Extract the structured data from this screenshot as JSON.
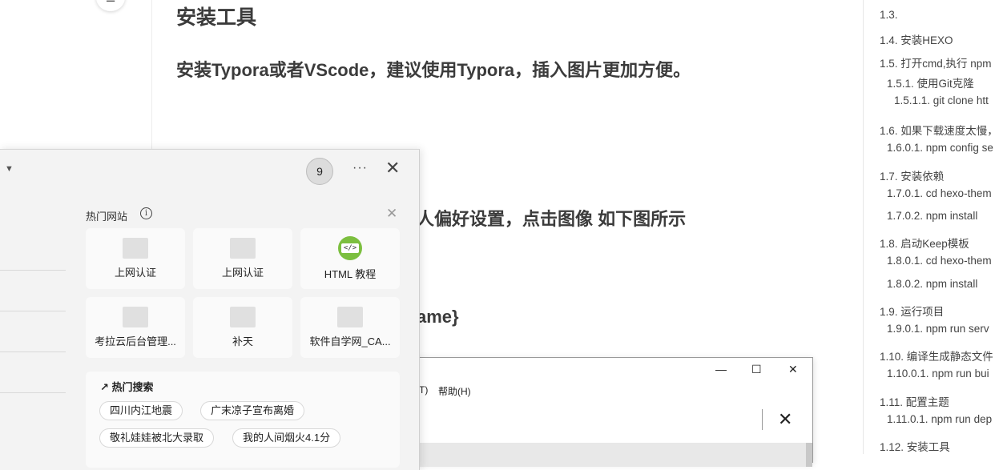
{
  "article": {
    "heading": "安装工具",
    "paragraph": "安装Typora或者VScode，建议使用Typora，插入图片更加方便。",
    "partial_pref": "人偏好设置，点击图像 如下图所示",
    "partial_name": "ame}"
  },
  "toc": {
    "items": [
      "1.3.",
      "1.4. 安装HEXO",
      "1.5. 打开cmd,执行 npm",
      "1.5.1. 使用Git克隆",
      "1.5.1.1. git clone htt",
      "1.6. 如果下载速度太慢，",
      "1.6.0.1. npm config se",
      "1.7. 安装依赖",
      "1.7.0.1. cd hexo-them",
      "1.7.0.2. npm install",
      "1.8. 启动Keep模板",
      "1.8.0.1. cd hexo-them",
      "1.8.0.2. npm install",
      "1.9. 运行项目",
      "1.9.0.1. npm run serv",
      "1.10. 编译生成静态文件",
      "1.10.0.1. npm run bui",
      "1.11. 配置主题",
      "1.11.0.1. npm run dep",
      "1.12. 安装工具"
    ]
  },
  "inner_window": {
    "menu_fragment": "T)",
    "menu_help": "帮助(H)",
    "minimize": "—",
    "maximize": "☐",
    "close": "✕",
    "big_close": "✕"
  },
  "panel": {
    "badge": "9",
    "more": "···",
    "close": "✕",
    "hot_sites_title": "热门网站",
    "hot_close": "✕",
    "sites": [
      {
        "label": "上网认证",
        "icon": "placeholder-icon"
      },
      {
        "label": "上网认证",
        "icon": "placeholder-icon"
      },
      {
        "label": "HTML 教程",
        "icon": "html-code-icon"
      },
      {
        "label": "考拉云后台管理...",
        "icon": "placeholder-icon"
      },
      {
        "label": "补天",
        "icon": "placeholder-icon"
      },
      {
        "label": "软件自学网_CA...",
        "icon": "placeholder-icon"
      }
    ],
    "hot_search_title": "热门搜索",
    "searches": [
      "四川内江地震",
      "广末凉子宣布离婚",
      "敬礼娃娃被北大录取",
      "我的人间烟火4.1分"
    ]
  },
  "colors": {
    "html_icon": "#7cbf3f",
    "panel_bg": "#f3f3f3"
  }
}
